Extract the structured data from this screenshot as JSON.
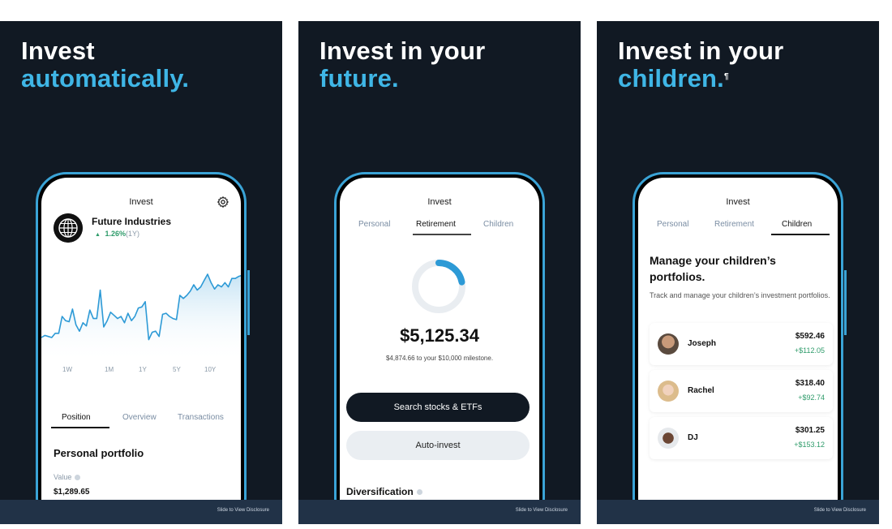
{
  "colors": {
    "panel_bg": "#111923",
    "accent": "#3fb6e6",
    "footer_bg": "#213247",
    "gain": "#2e9b6a"
  },
  "footer_text": "Slide to View Disclosure",
  "panels": [
    {
      "headline_white": "Invest",
      "headline_blue": "automatically.",
      "screen": {
        "title": "Invest",
        "settings_icon": "gear-icon",
        "stock": {
          "logo_icon": "globe-icon",
          "name": "Future Industries",
          "change": "1.26%",
          "period": "(1Y)",
          "direction_icon": "triangle-up-icon"
        },
        "ranges": [
          "1W",
          "1M",
          "1Y",
          "5Y",
          "10Y"
        ],
        "active_range": "1W",
        "tabs": [
          "Position",
          "Overview",
          "Transactions"
        ],
        "active_tab": "Position",
        "section_title": "Personal portfolio",
        "value_label": "Value",
        "value": "$1,289.65"
      }
    },
    {
      "headline_white": "Invest in your",
      "headline_blue": "future.",
      "screen": {
        "title": "Invest",
        "tabs": [
          "Personal",
          "Retirement",
          "Children"
        ],
        "active_tab": "Retirement",
        "milestone_progress": 0.22,
        "amount": "$5,125.34",
        "milestone_text": "$4,874.66 to your $10,000 milestone.",
        "primary_button": "Search stocks & ETFs",
        "secondary_button": "Auto-invest",
        "section_title": "Diversification"
      }
    },
    {
      "headline_white": "Invest in your",
      "headline_blue": "children.",
      "footnote_mark": "¶",
      "screen": {
        "title": "Invest",
        "tabs": [
          "Personal",
          "Retirement",
          "Children"
        ],
        "active_tab": "Children",
        "heading": "Manage your children’s portfolios.",
        "description": "Track and manage your children’s investment portfolios.",
        "children": [
          {
            "name": "Joseph",
            "value": "$592.46",
            "gain": "+$112.05",
            "avatar_color": "#8a6a55"
          },
          {
            "name": "Rachel",
            "value": "$318.40",
            "gain": "+$92.74",
            "avatar_color": "#d8b98f"
          },
          {
            "name": "DJ",
            "value": "$301.25",
            "gain": "+$153.12",
            "avatar_color": "#4a3428"
          }
        ]
      }
    }
  ],
  "chart_data": {
    "type": "area",
    "title": "",
    "xlabel": "",
    "ylabel": "",
    "range": "1W",
    "values": [
      10,
      12,
      11,
      10,
      14,
      14,
      30,
      26,
      25,
      37,
      22,
      16,
      24,
      21,
      36,
      28,
      28,
      55,
      20,
      26,
      34,
      31,
      28,
      30,
      24,
      33,
      26,
      30,
      38,
      39,
      44,
      8,
      15,
      16,
      11,
      32,
      33,
      30,
      28,
      27,
      50,
      47,
      50,
      54,
      60,
      55,
      58,
      64,
      70,
      62,
      56,
      60,
      58,
      62,
      58,
      66,
      66,
      68,
      69,
      70
    ],
    "ylim": [
      0,
      80
    ]
  }
}
